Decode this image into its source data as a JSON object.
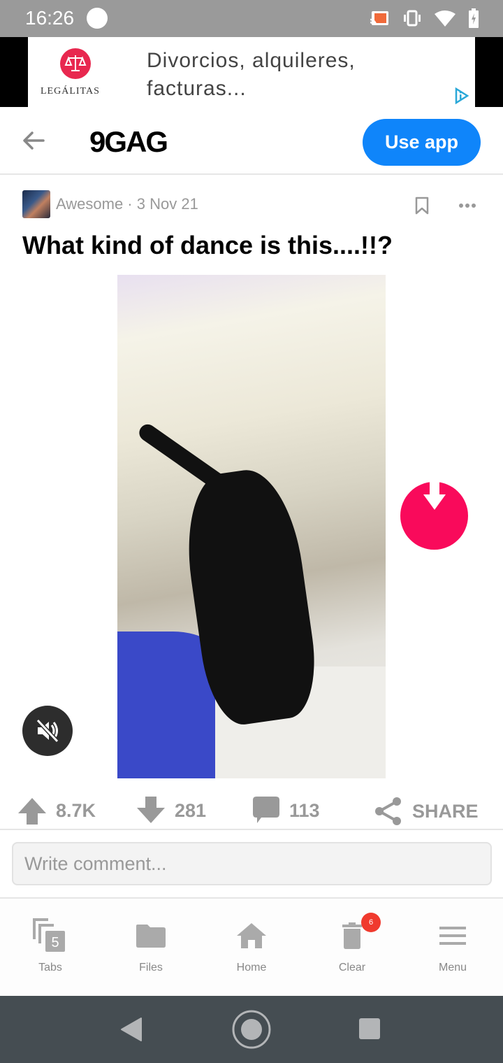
{
  "status_bar": {
    "time": "16:26"
  },
  "ad": {
    "brand": "LEGÁLITAS",
    "headline_line1": "Divorcios, alquileres,",
    "headline_line2": "facturas...",
    "accent_color": "#e8284f"
  },
  "header": {
    "logo": "9GAG",
    "use_app_label": "Use app",
    "accent_color": "#0f85fa"
  },
  "post": {
    "section": "Awesome",
    "date": "3 Nov 21",
    "meta": "Awesome · 3 Nov 21",
    "title": "What kind of dance is this....!!?",
    "upvotes": "8.7K",
    "downvotes": "281",
    "comments": "113",
    "share_label": "SHARE"
  },
  "comment": {
    "placeholder": "Write comment..."
  },
  "bottom_nav": {
    "items": [
      {
        "label": "Tabs",
        "icon": "tabs-icon",
        "count": "5"
      },
      {
        "label": "Files",
        "icon": "folder-icon"
      },
      {
        "label": "Home",
        "icon": "home-icon"
      },
      {
        "label": "Clear",
        "icon": "trash-icon",
        "badge": "6"
      },
      {
        "label": "Menu",
        "icon": "menu-icon"
      }
    ]
  },
  "colors": {
    "download_button": "#f90a5b",
    "badge": "#f03a2e"
  }
}
